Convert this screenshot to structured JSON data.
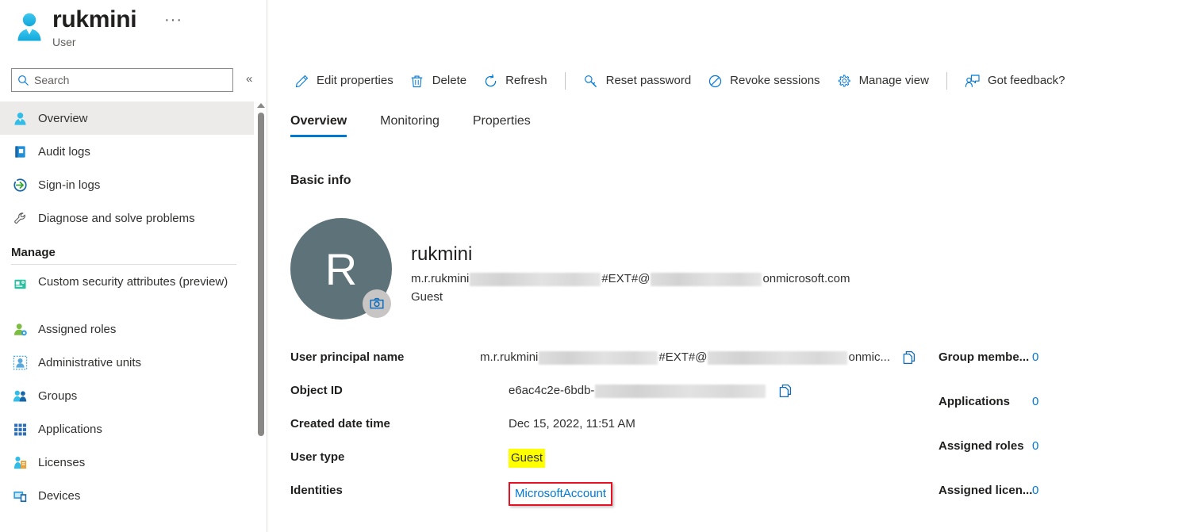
{
  "blade": {
    "title": "rukmini",
    "subtitle": "User",
    "ellipsis": "···",
    "icon": "user-icon",
    "collapse_glyph": "«"
  },
  "search": {
    "placeholder": "Search",
    "value": "",
    "icon": "search-icon"
  },
  "sidebar": {
    "items": [
      {
        "label": "Overview",
        "icon": "user-icon",
        "selected": true
      },
      {
        "label": "Audit logs",
        "icon": "book-icon",
        "selected": false
      },
      {
        "label": "Sign-in logs",
        "icon": "sign-in-icon",
        "selected": false
      },
      {
        "label": "Diagnose and solve problems",
        "icon": "wrench-icon",
        "selected": false
      }
    ],
    "group_title": "Manage",
    "manage_items": [
      {
        "label": "Custom security attributes (preview)",
        "icon": "attributes-icon",
        "selected": false,
        "two_line": true
      },
      {
        "label": "Assigned roles",
        "icon": "assigned-roles-icon",
        "selected": false
      },
      {
        "label": "Administrative units",
        "icon": "administrative-units-icon",
        "selected": false
      },
      {
        "label": "Groups",
        "icon": "groups-icon",
        "selected": false
      },
      {
        "label": "Applications",
        "icon": "applications-grid-icon",
        "selected": false
      },
      {
        "label": "Licenses",
        "icon": "licenses-icon",
        "selected": false
      },
      {
        "label": "Devices",
        "icon": "devices-icon",
        "selected": false
      }
    ]
  },
  "toolbar": {
    "buttons": [
      {
        "label": "Edit properties",
        "icon": "pencil-icon"
      },
      {
        "label": "Delete",
        "icon": "trash-icon"
      },
      {
        "label": "Refresh",
        "icon": "refresh-icon"
      },
      {
        "label": "Reset password",
        "icon": "key-icon"
      },
      {
        "label": "Revoke sessions",
        "icon": "block-icon"
      },
      {
        "label": "Manage view",
        "icon": "gear-icon"
      },
      {
        "label": "Got feedback?",
        "icon": "feedback-icon"
      }
    ]
  },
  "tabs": [
    {
      "label": "Overview",
      "active": true
    },
    {
      "label": "Monitoring",
      "active": false
    },
    {
      "label": "Properties",
      "active": false
    }
  ],
  "main": {
    "section_title": "Basic info",
    "profile": {
      "avatar_initial": "R",
      "avatar_color": "#5e7279",
      "name": "rukmini",
      "upn_prefix": "m.r.rukmini",
      "upn_middle": "#EXT#@",
      "upn_suffix": "onmicrosoft.com",
      "user_type": "Guest",
      "camera_icon": "camera-icon"
    },
    "details": [
      {
        "label": "User principal name",
        "value_prefix": "m.r.rukmini",
        "value_middle": "#EXT#@",
        "value_suffix": "onmic...",
        "copy_icon": "copy-icon",
        "redacted": true
      },
      {
        "label": "Object ID",
        "value_prefix": "e6ac4c2e-6bdb-",
        "value_middle": "",
        "value_suffix": "",
        "copy_icon": "copy-icon",
        "redacted": true
      },
      {
        "label": "Created date time",
        "value_prefix": "Dec 15, 2022, 11:51 AM",
        "value_middle": "",
        "value_suffix": "",
        "copy_icon": null,
        "redacted": false
      },
      {
        "label": "User type",
        "value_prefix": "Guest",
        "value_middle": "",
        "value_suffix": "",
        "copy_icon": null,
        "redacted": false,
        "highlight": "#ffff00"
      },
      {
        "label": "Identities",
        "value_prefix": "MicrosoftAccount",
        "value_middle": "",
        "value_suffix": "",
        "copy_icon": null,
        "redacted": false,
        "link": true,
        "annotation_box": "#e81123"
      }
    ],
    "stats": [
      {
        "label": "Group membe...",
        "value": "0"
      },
      {
        "label": "Applications",
        "value": "0"
      },
      {
        "label": "Assigned roles",
        "value": "0"
      },
      {
        "label": "Assigned licen...",
        "value": "0"
      }
    ]
  },
  "colors": {
    "accent": "#0078d4",
    "highlight": "#ffff00",
    "annotation": "#e81123",
    "selected_bg": "#edebe9"
  }
}
